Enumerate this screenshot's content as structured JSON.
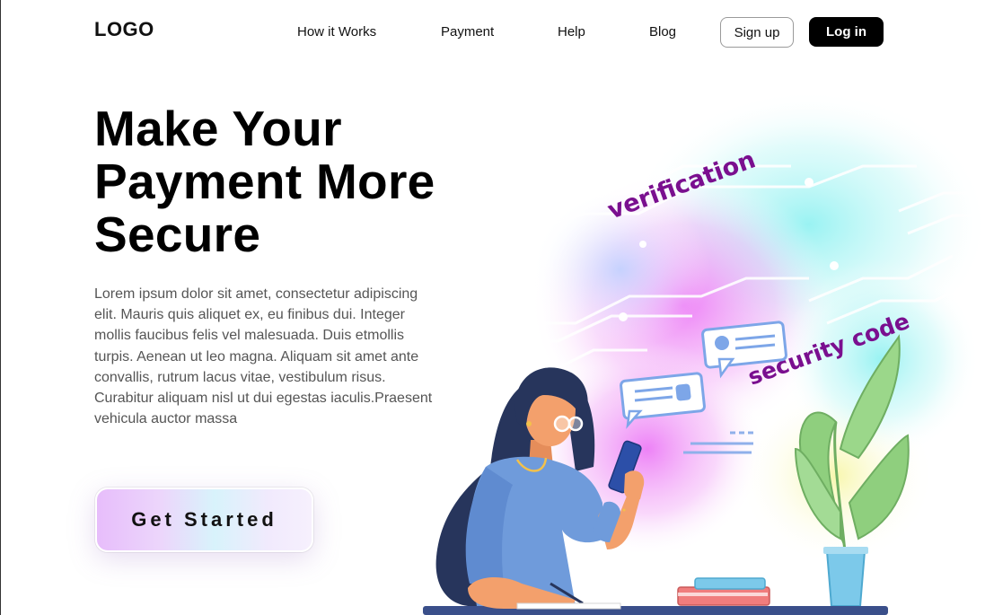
{
  "header": {
    "logo": "LOGO",
    "nav": [
      "How it Works",
      "Payment",
      "Help",
      "Blog"
    ],
    "signup_label": "Sign up",
    "login_label": "Log in"
  },
  "hero": {
    "title_lines": [
      "Make Your",
      "Payment More",
      "Secure"
    ],
    "body_lines": [
      "Lorem ipsum dolor sit amet, consectetur adipiscing",
      "elit. Mauris quis aliquet ex, eu finibus dui. Integer",
      "mollis faucibus felis vel malesuada. Duis etmollis",
      "turpis. Aenean ut leo magna. Aliquam sit amet ante",
      "convallis, rutrum lacus vitae, vestibulum risus.",
      "Curabitur aliquam nisl ut dui egestas iaculis.Praesent",
      "vehicula auctor massa"
    ],
    "cta_label": "Get Started"
  },
  "illustration": {
    "word_verification": "verification",
    "word_security": "security code"
  },
  "colors": {
    "text": "#111111",
    "muted_text": "#555555",
    "login_bg": "#000000",
    "accent_purple": "#7a0f8f",
    "shirt_blue": "#6f9bdb",
    "hair_navy": "#27355c",
    "skin": "#f3a06c",
    "plant_green": "#8fcf7e",
    "pot_blue": "#7cc9ea"
  }
}
